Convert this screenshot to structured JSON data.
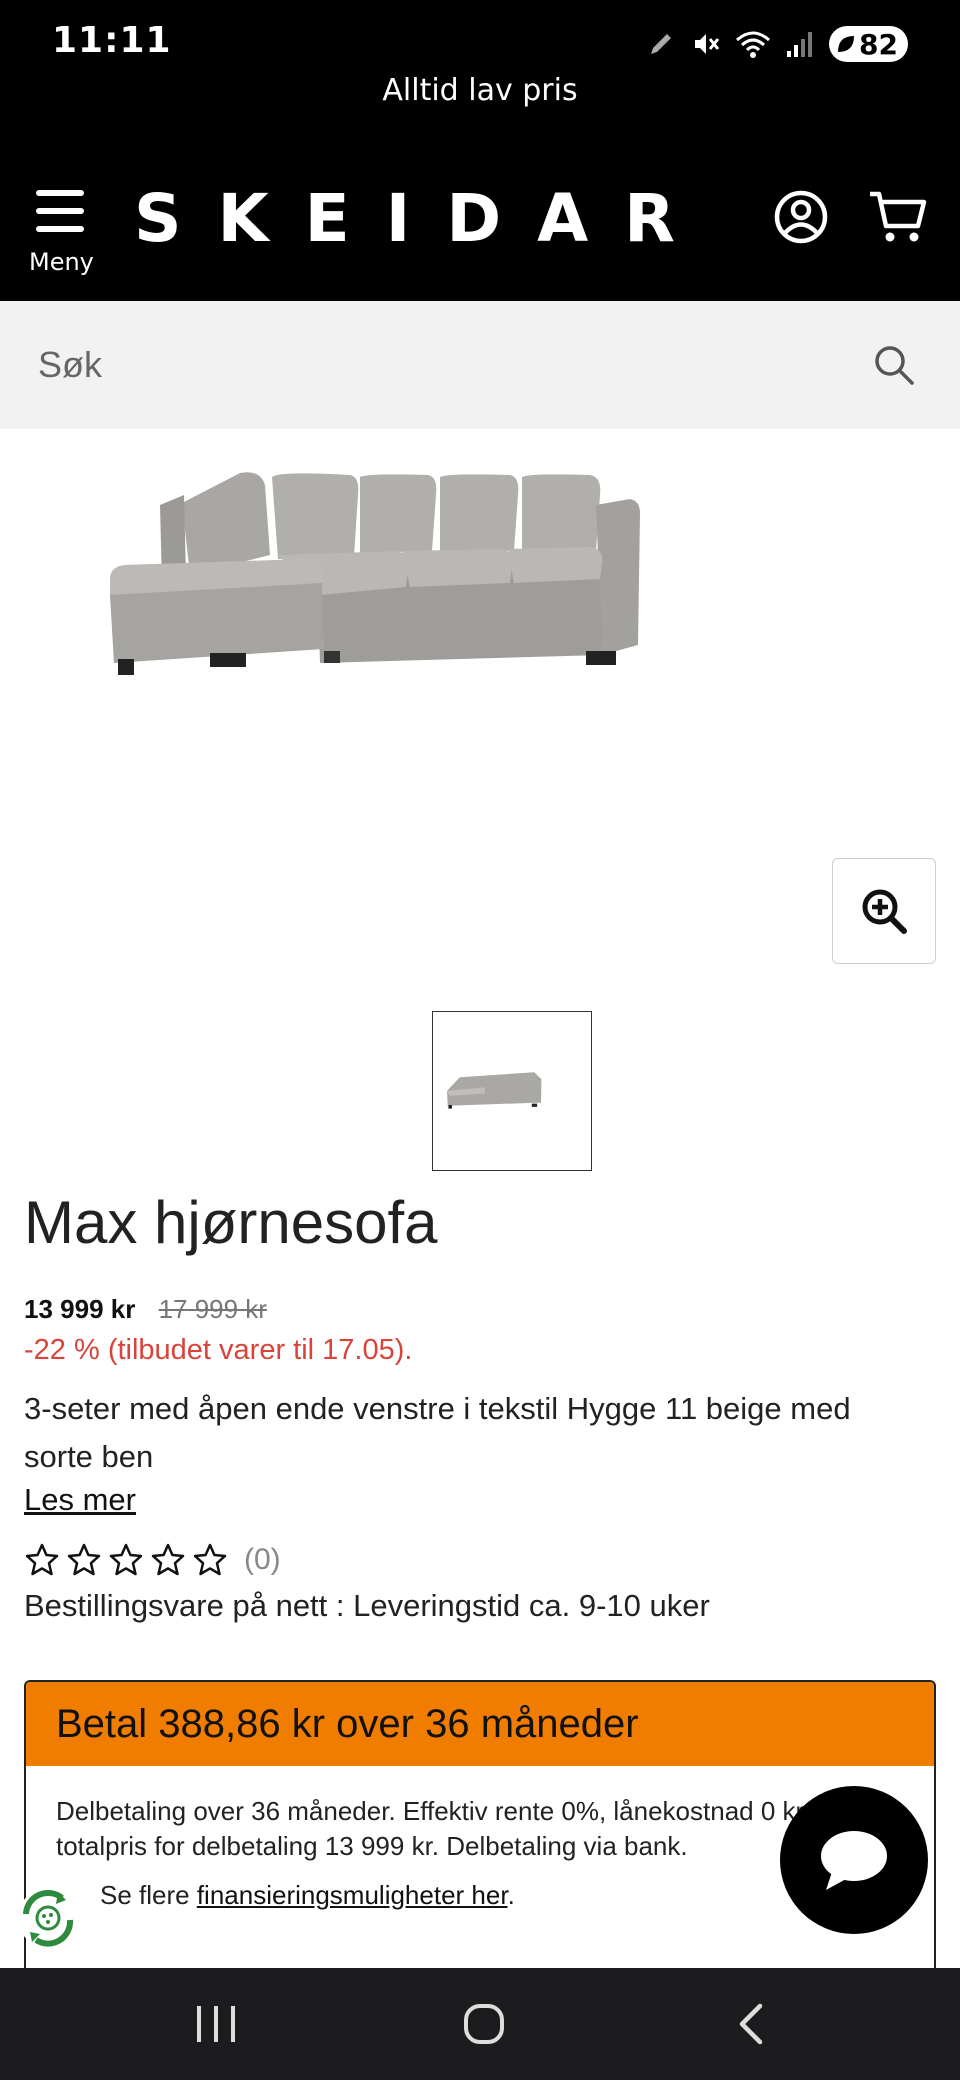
{
  "status_bar": {
    "time": "11:11",
    "battery": "82",
    "icons": [
      "pen-icon",
      "mute-icon",
      "wifi-icon",
      "signal-icon",
      "battery-icon"
    ]
  },
  "header": {
    "promo_text": "Alltid lav pris",
    "logo": "SKEIDAR",
    "menu_label": "Meny",
    "icons": [
      "menu-icon",
      "account-icon",
      "cart-icon"
    ]
  },
  "search": {
    "placeholder": "Søk",
    "icon": "search-icon"
  },
  "product": {
    "title": "Max hjørnesofa",
    "price": "13 999 kr",
    "old_price": "17 999 kr",
    "discount_text": "-22 % (tilbudet varer til 17.05).",
    "description": "3-seter med åpen ende venstre i tekstil Hygge 11 beige med sorte ben",
    "read_more": "Les mer",
    "rating_stars": 0,
    "rating_max": 5,
    "review_count": "(0)",
    "delivery": "Bestillingsvare på nett : Leveringstid ca. 9-10 uker"
  },
  "financing": {
    "headline": "Betal 388,86 kr over 36 måneder",
    "details": "Delbetaling over 36 måneder. Effektiv rente 0%, lånekostnad 0 kr, totalpris for delbetaling 13 999 kr. Delbetaling via bank.",
    "more_prefix": "Se flere ",
    "more_link": "finansieringsmuligheter her",
    "more_suffix": "."
  },
  "colors": {
    "header_bg": "#000000",
    "accent_orange": "#f07d00",
    "discount_red": "#d9443a",
    "search_bg": "#f2f2f2"
  }
}
